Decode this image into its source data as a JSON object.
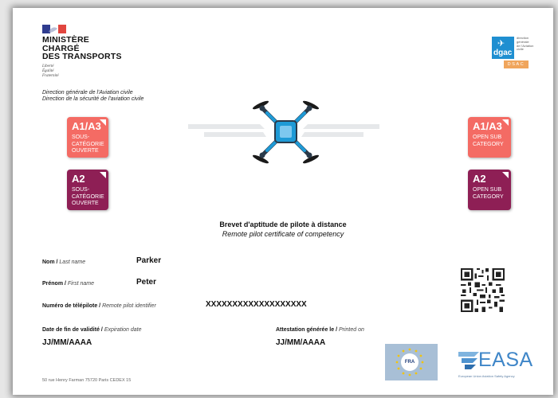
{
  "ministry": {
    "lines": [
      "MINISTÈRE",
      "CHARGÉ",
      "DES TRANSPORTS"
    ],
    "motto": [
      "Liberté",
      "Égalité",
      "Fraternité"
    ],
    "directorate_line1": "Direction générale de l'Aviation civile",
    "directorate_line2": "Direction de la sécurité de l'aviation civile"
  },
  "dgac_logo": {
    "word": "dgac",
    "small": [
      "direction",
      "générale",
      "de l'Aviation",
      "civile"
    ],
    "bar": "DSAC"
  },
  "badges": {
    "left_a1": {
      "code": "A1/A3",
      "desc": [
        "SOUS-",
        "CATÉGORIE",
        "OUVERTE"
      ]
    },
    "left_a2": {
      "code": "A2",
      "desc": [
        "SOUS-",
        "CATÉGORIE",
        "OUVERTE"
      ]
    },
    "right_a1": {
      "code": "A1/A3",
      "desc": [
        "OPEN SUB",
        "CATEGORY"
      ]
    },
    "right_a2": {
      "code": "A2",
      "desc": [
        "OPEN SUB",
        "CATEGORY"
      ]
    }
  },
  "certificate": {
    "title": "Brevet d'aptitude de pilote à distance",
    "subtitle": "Remote pilot certificate of competency"
  },
  "fields": {
    "last_name_label_fr": "Nom /",
    "last_name_label_en": "Last name",
    "last_name_value": "Parker",
    "first_name_label_fr": "Prénom /",
    "first_name_label_en": "First name",
    "first_name_value": "Peter",
    "pilot_id_label_fr": "Numéro de télépilote /",
    "pilot_id_label_en": "Remote pilot identifier",
    "pilot_id_value": "XXXXXXXXXXXXXXXXXXX",
    "expiry_label_fr": "Date de fin de validité /",
    "expiry_label_en": "Expiration date",
    "expiry_value": "JJ/MM/AAAA",
    "printed_label_fr": "Attestation générée le /",
    "printed_label_en": "Printed on",
    "printed_value": "JJ/MM/AAAA"
  },
  "logos": {
    "fra": "FRA",
    "easa": "EASA",
    "easa_sub": "European Union Aviation Safety Agency"
  },
  "address": "50 rue Henry Farman 75720 Paris CEDEX 15",
  "colors": {
    "badge_a1": "#f46b64",
    "badge_a2": "#8e1f55",
    "easa_blue": "#3f86c8",
    "dgac_blue": "#1f8fd1",
    "dsac_orange": "#f0a55c"
  }
}
